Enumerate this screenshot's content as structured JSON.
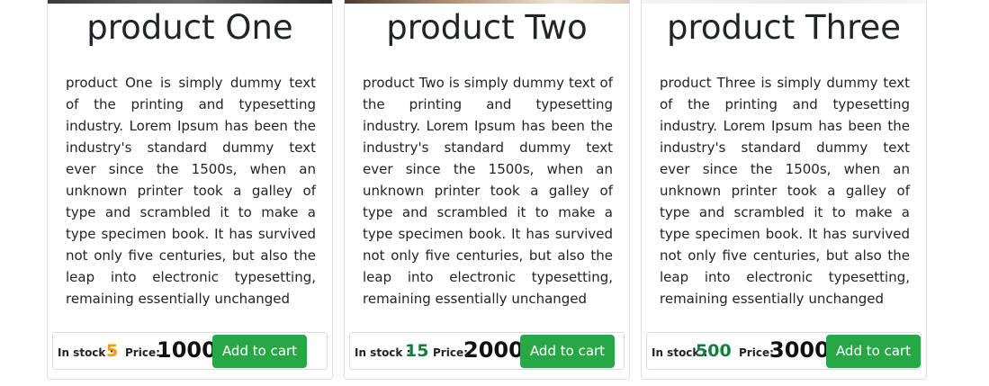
{
  "products": [
    {
      "title": "product One",
      "description": "product One is simply dummy text of the printing and typesetting industry. Lorem Ipsum has been the industry's standard dummy text ever since the 1500s, when an unknown printer took a galley of type and scrambled it to make a type specimen book. It has survived not only five centuries, but also the leap into electronic typesetting, remaining essentially unchanged",
      "stock_label": "In stock :",
      "stock_value": "5",
      "stock_color": "#ff9900",
      "price_label": "Price:",
      "price_value": "1000",
      "button_label": "Add to cart"
    },
    {
      "title": "product Two",
      "description": "product Two is simply dummy text of the printing and typesetting industry. Lorem Ipsum has been the industry's standard dummy text ever since the 1500s, when an unknown printer took a galley of type and scrambled it to make a type specimen book. It has survived not only five centuries, but also the leap into electronic typesetting, remaining essentially unchanged",
      "stock_label": "In stock :",
      "stock_value": "15",
      "stock_color": "#15803d",
      "price_label": "Price:",
      "price_value": "2000",
      "button_label": "Add to cart"
    },
    {
      "title": "product Three",
      "description": "product Three is simply dummy text of the printing and typesetting industry. Lorem Ipsum has been the industry's standard dummy text ever since the 1500s, when an unknown printer took a galley of type and scrambled it to make a type specimen book. It has survived not only five centuries, but also the leap into electronic typesetting, remaining essentially unchanged",
      "stock_label": "In stock :",
      "stock_value": "500",
      "stock_color": "#15803d",
      "price_label": "Price:",
      "price_value": "3000",
      "button_label": "Add to cart"
    }
  ],
  "colors": {
    "button_bg": "#28a745",
    "low_stock": "#ff9900",
    "in_stock": "#15803d"
  }
}
